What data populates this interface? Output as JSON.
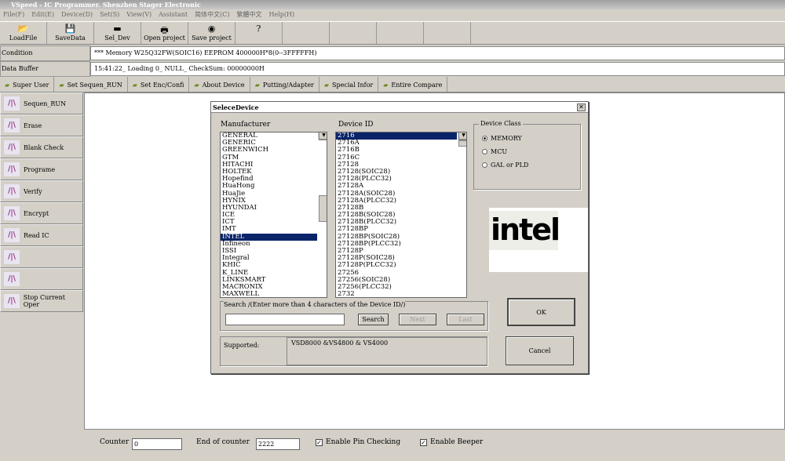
{
  "window": {
    "title": "VSpeed - IC Programmer.  Shenzhen Stager Electronic"
  },
  "menu": [
    "File(F)",
    "Edit(E)",
    "Device(D)",
    "Set(S)",
    "View(V)",
    "Assistant",
    "简体中文(C)",
    "繁體中文",
    "Help(H)"
  ],
  "toolbar": [
    {
      "label": "LoadFile",
      "icon": "📂"
    },
    {
      "label": "SaveData",
      "icon": "💾"
    },
    {
      "label": "Sel_Dev",
      "icon": "▬"
    },
    {
      "label": "Open project",
      "icon": "🖶"
    },
    {
      "label": "Save project",
      "icon": "◉"
    },
    {
      "label": "",
      "icon": "?"
    }
  ],
  "condition": {
    "label": "Condition",
    "value": "***    Memory  W25Q32FW(SOIC16)  EEPROM 400000H*8(0--3FFFFFH)"
  },
  "buffer": {
    "label": "Data Buffer",
    "value": "15:41:22_ Loading 0_ NULL_  CheckSum: 00000000H"
  },
  "tabs": [
    "Super User",
    "Set Sequen_RUN",
    "Set Enc/Confi",
    "About Device",
    "Putting/Adapter",
    "Special Infor",
    "Entire Compare"
  ],
  "sidebar": [
    "Sequen_RUN",
    "Erase",
    "Blank Check",
    "Programe",
    "Verify",
    "Encrypt",
    "Read IC",
    "",
    "",
    "Stop Current Oper"
  ],
  "dialog": {
    "title": "SeleceDevice",
    "manufacturer_label": "Manufacturer",
    "device_label": "Device ID",
    "manufacturers": [
      "GENERAL",
      "GENERIC",
      "GREENWICH",
      "GTM",
      "HITACHI",
      "HOLTEK",
      "Hopefind",
      "HuaHong",
      "HuaJie",
      "HYNIX",
      "HYUNDAI",
      "ICE",
      "ICT",
      "IMT",
      "INTEL",
      "Infineon",
      "ISSI",
      "Integral",
      "KHIC",
      "K_LINE",
      "LINKSMART",
      "MACRONIX",
      "MAXWELL"
    ],
    "selected_manufacturer": "INTEL",
    "devices": [
      "2716",
      "2716A",
      "2716B",
      "2716C",
      "27128",
      "27128(SOIC28)",
      "27128(PLCC32)",
      "27128A",
      "27128A(SOIC28)",
      "27128A(PLCC32)",
      "27128B",
      "27128B(SOIC28)",
      "27128B(PLCC32)",
      "27128BP",
      "27128BP(SOIC28)",
      "27128BP(PLCC32)",
      "27128P",
      "27128P(SOIC28)",
      "27128P(PLCC32)",
      "27256",
      "27256(SOIC28)",
      "27256(PLCC32)",
      "2732"
    ],
    "selected_device": "2716",
    "device_class_label": "Device Class",
    "device_classes": [
      "MEMORY",
      "MCU",
      "GAL or PLD"
    ],
    "selected_class": "MEMORY",
    "logo": "intel",
    "search_label": "Search /(Enter more than 4 characters of the Device ID/)",
    "search_value": "",
    "search_btn": "Search",
    "next_btn": "Next",
    "last_btn": "Last",
    "supported_label": "Supported:",
    "supported_value": "VSD8000 &VS4800 & VS4000",
    "ok": "OK",
    "cancel": "Cancel"
  },
  "bottom": {
    "counter_label": "Counter",
    "counter_value": "0",
    "end_label": "End of counter",
    "end_value": "2222",
    "pin_check": "Enable Pin Checking",
    "beeper": "Enable Beeper"
  }
}
